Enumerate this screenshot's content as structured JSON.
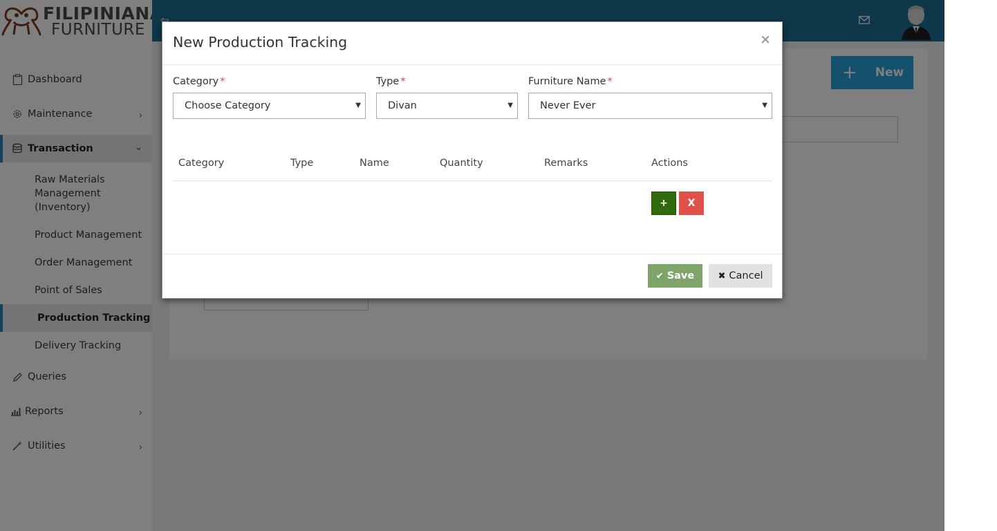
{
  "brand": {
    "line1": "FILIPINIANA",
    "line2": "FURNITURE"
  },
  "sidebar": {
    "items": [
      {
        "label": "Dashboard",
        "icon": "clipboard-icon"
      },
      {
        "label": "Maintenance",
        "icon": "gear-icon",
        "chevron": "›"
      },
      {
        "label": "Transaction",
        "icon": "database-icon",
        "chevron": "⌄"
      },
      {
        "label": "Queries",
        "icon": "pencil-icon"
      },
      {
        "label": "Reports",
        "icon": "bar-chart-icon",
        "chevron": "›"
      },
      {
        "label": "Utilities",
        "icon": "wand-icon",
        "chevron": "›"
      }
    ],
    "subitems": [
      {
        "label": "Raw Materials Management (Inventory)"
      },
      {
        "label": "Product Management"
      },
      {
        "label": "Order Management"
      },
      {
        "label": "Point of Sales"
      },
      {
        "label": "Production Tracking"
      },
      {
        "label": "Delivery Tracking"
      }
    ]
  },
  "topbar": {
    "back_icon": "⇦",
    "mail_icon": "mail-icon"
  },
  "content": {
    "new_button_label": "New",
    "new_button_plus": "+"
  },
  "modal": {
    "title": "New Production Tracking",
    "close": "×",
    "fields": {
      "category": {
        "label": "Category",
        "required": "*",
        "value": "Choose Category"
      },
      "type": {
        "label": "Type",
        "required": "*",
        "value": "Divan"
      },
      "furniture_name": {
        "label": "Furniture Name",
        "required": "*",
        "value": "Never Ever"
      }
    },
    "table": {
      "headers": [
        "Category",
        "Type",
        "Name",
        "Quantity",
        "Remarks",
        "Actions"
      ],
      "add_label": "+",
      "remove_label": "X"
    },
    "footer": {
      "save_label": "Save",
      "save_icon": "✔",
      "cancel_label": "Cancel",
      "cancel_icon": "✖"
    }
  },
  "colors": {
    "topbar": "#1d6f93",
    "accent_border": "#2d7fb0",
    "new_button": "#2aa3d8",
    "add_button": "#2f6b0c",
    "remove_button": "#e0514a",
    "save_button": "#7fa46a",
    "required": "#e03c3c"
  }
}
